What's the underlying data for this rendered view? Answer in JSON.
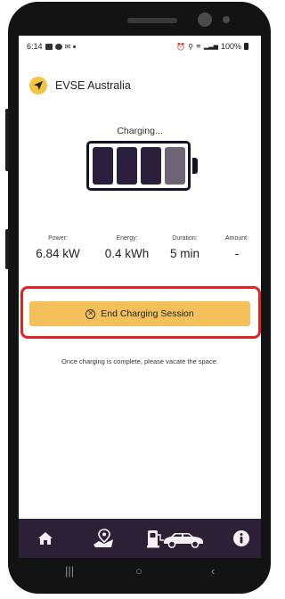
{
  "statusbar": {
    "time": "6:14",
    "battery": "100%"
  },
  "header": {
    "brand_name": "EVSE Australia",
    "brand_icon": "navigation-arrow-icon"
  },
  "charging": {
    "status": "Charging...",
    "battery_cells_filled": 3,
    "battery_cells_total": 4
  },
  "stats": {
    "power": {
      "label": "Power:",
      "value": "6.84 kW"
    },
    "energy": {
      "label": "Energy:",
      "value": "0.4 kWh"
    },
    "duration": {
      "label": "Duration:",
      "value": "5 min"
    },
    "amount": {
      "label": "Amount:",
      "value": "-"
    }
  },
  "actions": {
    "end_label": "End Charging Session"
  },
  "hint": "Once charging is complete, please vacate the space.",
  "bottom_nav": {
    "items": [
      "home-icon",
      "map-location-icon",
      "charger-car-icon",
      "info-icon"
    ]
  },
  "colors": {
    "accent": "#f4c05a",
    "nav_bg": "#2c2037",
    "battery_cell": "#2a1f3d",
    "battery_cell_empty": "#6d6476",
    "highlight": "#e02426"
  }
}
